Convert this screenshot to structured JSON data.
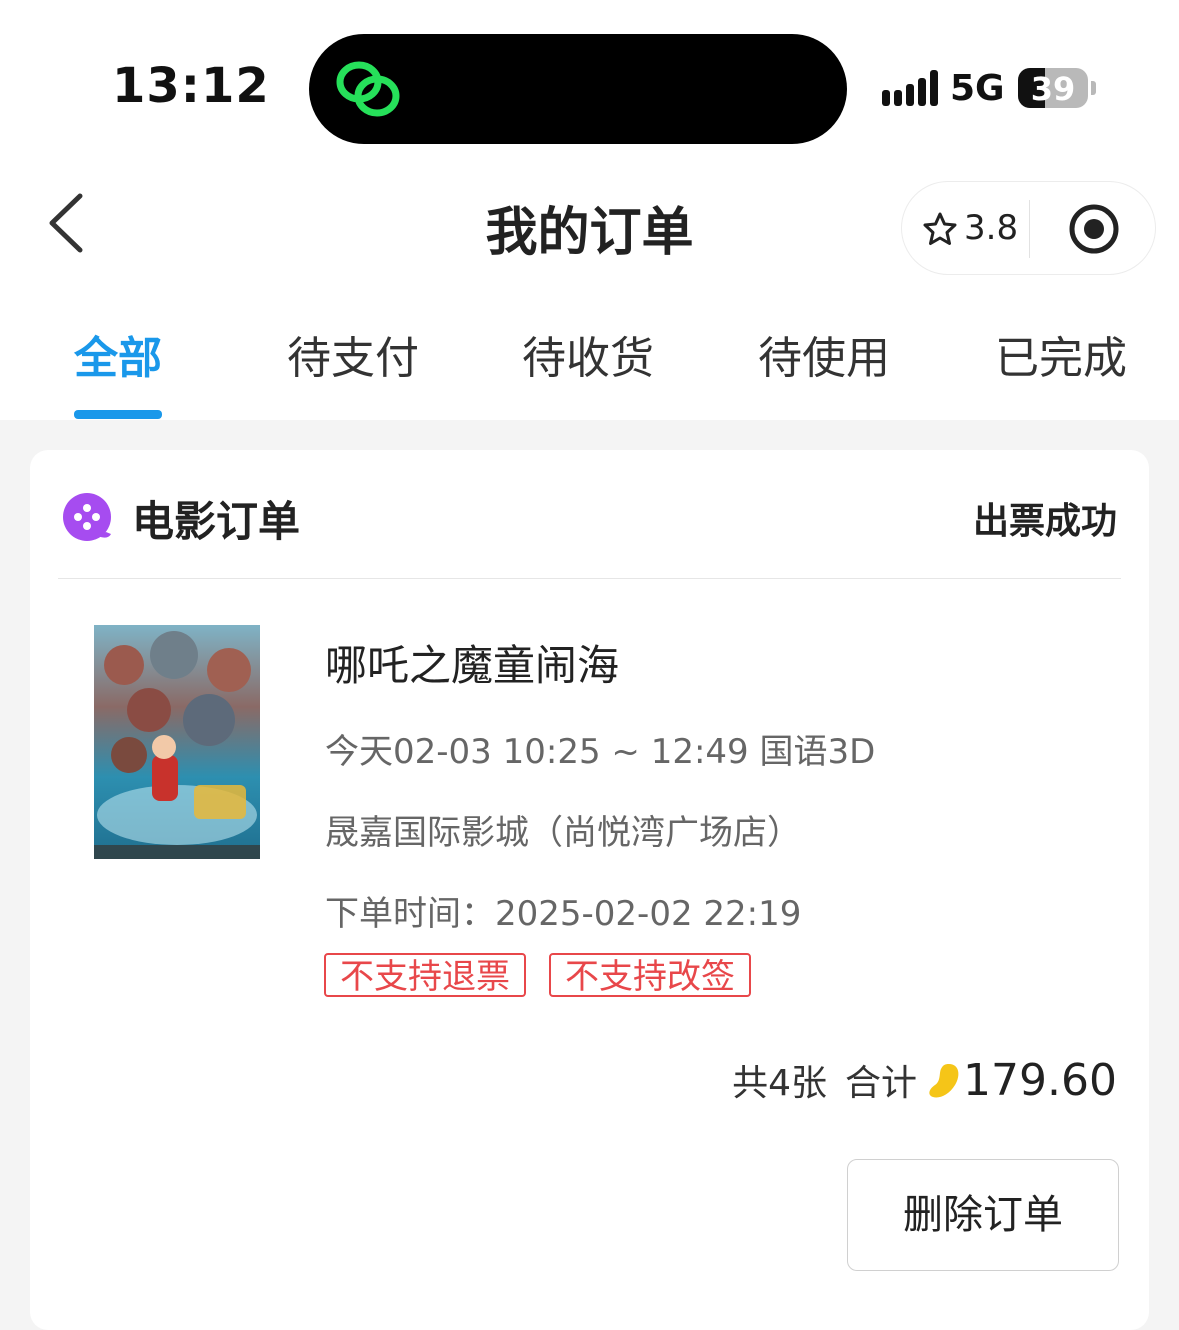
{
  "status_bar": {
    "time": "13:12",
    "network": "5G",
    "battery": "39",
    "battery_level_percent": 39,
    "island_icon": "chain-link-icon"
  },
  "nav": {
    "title": "我的订单",
    "rating": "3.8",
    "icons": [
      "back-icon",
      "star-icon",
      "target-icon"
    ]
  },
  "tabs": [
    {
      "label": "全部",
      "active": true
    },
    {
      "label": "待支付",
      "active": false
    },
    {
      "label": "待收货",
      "active": false
    },
    {
      "label": "待使用",
      "active": false
    },
    {
      "label": "已完成",
      "active": false
    }
  ],
  "order": {
    "category": "电影订单",
    "category_icon": "film-reel-icon",
    "status": "出票成功",
    "movie_title": "哪吒之魔童闹海",
    "showtime": "今天02-03 10:25 ~ 12:49 国语3D",
    "cinema": "晟嘉国际影城（尚悦湾广场店）",
    "order_time": "下单时间：2025-02-02 22:19",
    "tags": [
      "不支持退票",
      "不支持改签"
    ],
    "count": "共4张",
    "sum_label": "合计",
    "price": "179.60",
    "delete_button": "删除订单"
  },
  "colors": {
    "accent": "#1a98ea",
    "tag_red": "#e8474a",
    "category_purple": "#a64cf0",
    "coin_yellow": "#f5c518"
  }
}
